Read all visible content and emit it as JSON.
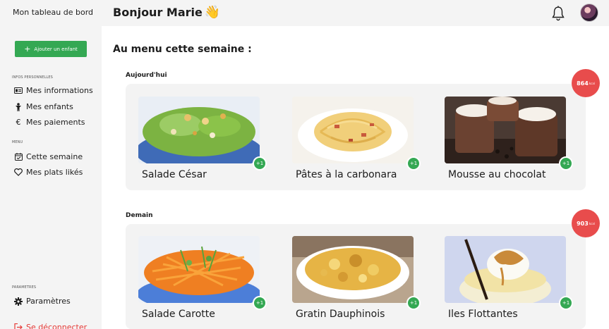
{
  "sidebar": {
    "brand": "Mon tableau de bord",
    "add_child_label": "Ajouter un enfant",
    "sections": [
      {
        "label": "INFOS PERSONNELLES",
        "items": [
          {
            "label": "Mes informations",
            "icon": "id-card-icon"
          },
          {
            "label": "Mes enfants",
            "icon": "child-icon"
          },
          {
            "label": "Mes paiements",
            "icon": "euro-icon"
          }
        ]
      },
      {
        "label": "MENU",
        "items": [
          {
            "label": "Cette semaine",
            "icon": "calendar-icon"
          },
          {
            "label": "Mes plats likés",
            "icon": "heart-icon"
          }
        ]
      },
      {
        "label": "PARAMETRES",
        "items": [
          {
            "label": "Paramètres",
            "icon": "gear-icon"
          },
          {
            "label": "Se déconnecter",
            "icon": "logout-icon"
          }
        ]
      }
    ]
  },
  "header": {
    "greeting": "Bonjour Marie",
    "greeting_emoji": "👋"
  },
  "main": {
    "title": "Au menu cette semaine :",
    "days": [
      {
        "label": "Aujourd'hui",
        "kcal_value": "864",
        "kcal_unit": "kcal",
        "dishes": [
          {
            "name": "Salade César",
            "likes": "+1"
          },
          {
            "name": "Pâtes à la carbonara",
            "likes": "+1"
          },
          {
            "name": "Mousse au chocolat",
            "likes": "+1"
          }
        ]
      },
      {
        "label": "Demain",
        "kcal_value": "903",
        "kcal_unit": "kcal",
        "dishes": [
          {
            "name": "Salade Carotte",
            "likes": "+1"
          },
          {
            "name": "Gratin Dauphinois",
            "likes": "+1"
          },
          {
            "name": "Iles Flottantes",
            "likes": "+1"
          }
        ]
      }
    ]
  },
  "colors": {
    "accent_green": "#34a853",
    "kcal_red": "#e84c4c",
    "logout_red": "#e53935",
    "sidebar_bg": "#f4f4f4"
  }
}
